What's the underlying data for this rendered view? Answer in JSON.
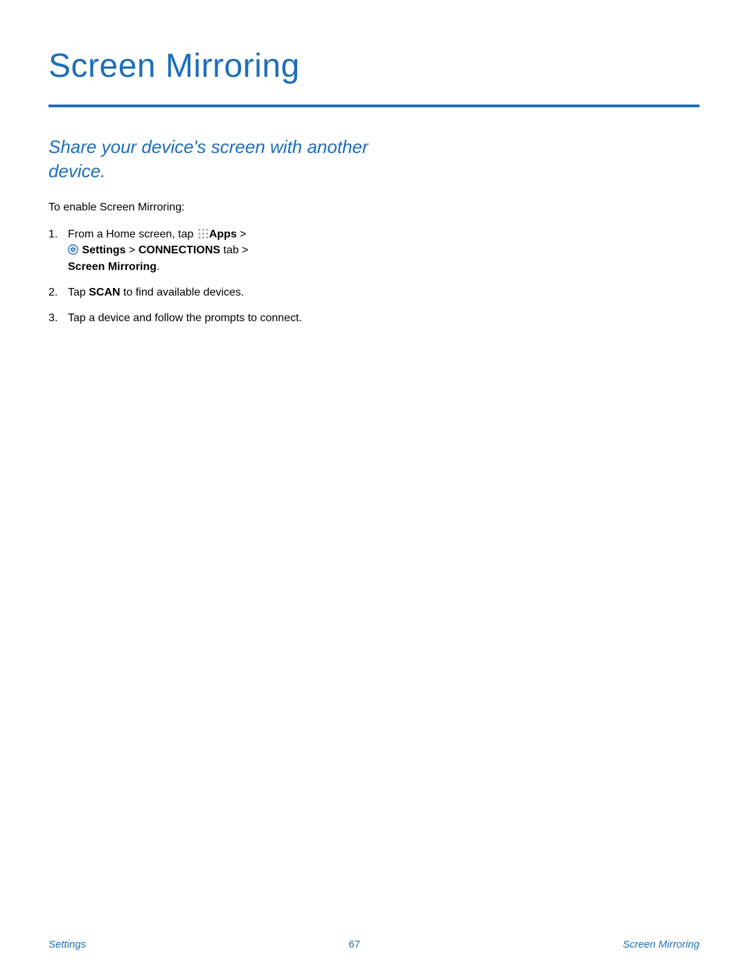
{
  "header": {
    "title": "Screen Mirroring"
  },
  "subtitle": "Share your device's screen with another device.",
  "intro": "To enable Screen Mirroring:",
  "steps": {
    "s1": {
      "num": "1.",
      "p1": "From a Home screen, tap ",
      "apps": "Apps",
      "gt1": " > ",
      "settings": "Settings",
      "gt2": " > ",
      "conn": "CONNECTIONS",
      "tab": " tab > ",
      "sm": "Screen Mirroring",
      "period": "."
    },
    "s2": {
      "num": "2.",
      "p1": "Tap ",
      "scan": "SCAN",
      "p2": " to find available devices."
    },
    "s3": {
      "num": "3.",
      "text": "Tap a device and follow the prompts to connect."
    }
  },
  "footer": {
    "left": "Settings",
    "center": "67",
    "right": "Screen Mirroring"
  }
}
